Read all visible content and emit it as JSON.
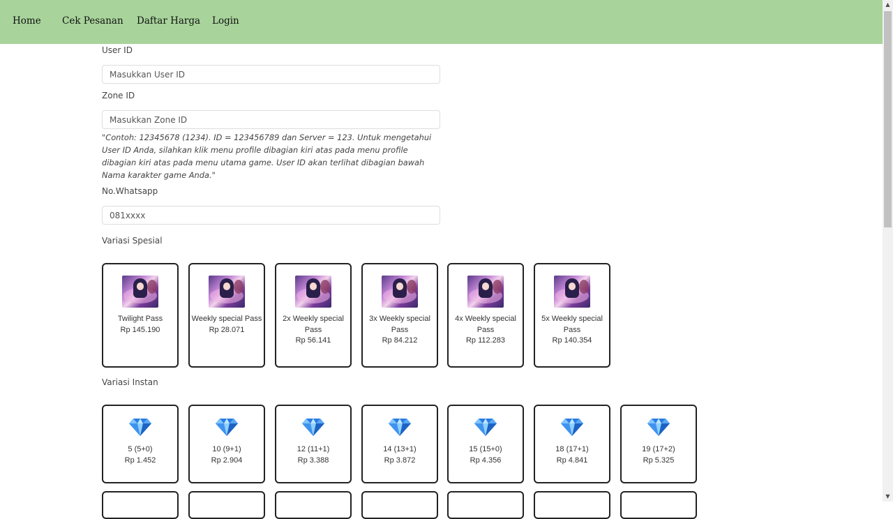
{
  "nav": {
    "items": [
      {
        "label": "Home"
      },
      {
        "label": "Cek Pesanan"
      },
      {
        "label": "Daftar Harga"
      },
      {
        "label": "Login"
      }
    ],
    "bg_color": "#a8d49b"
  },
  "form": {
    "user_id_label": "User ID",
    "user_id_placeholder": "Masukkan User ID",
    "zone_id_label": "Zone ID",
    "zone_id_placeholder": "Masukkan Zone ID",
    "hint": "\"Contoh: 12345678 (1234). ID = 123456789 dan Server = 123. Untuk mengetahui User ID Anda, silahkan klik menu profile dibagian kiri atas pada menu profile dibagian kiri atas pada menu utama game. User ID akan terlihat dibagian bawah Nama karakter game Anda.\"",
    "whatsapp_label": "No.Whatsapp",
    "whatsapp_placeholder": "081xxxx"
  },
  "special": {
    "title": "Variasi Spesial",
    "items": [
      {
        "name": "Twilight Pass",
        "price": "Rp 145.190"
      },
      {
        "name": "Weekly special Pass",
        "price": "Rp 28.071"
      },
      {
        "name": "2x Weekly special Pass",
        "price": "Rp 56.141"
      },
      {
        "name": "3x Weekly special Pass",
        "price": "Rp 84.212"
      },
      {
        "name": "4x Weekly special Pass",
        "price": "Rp 112.283"
      },
      {
        "name": "5x Weekly special Pass",
        "price": "Rp 140.354"
      }
    ]
  },
  "instant": {
    "title": "Variasi Instan",
    "items": [
      {
        "name": "5 (5+0)",
        "price": "Rp 1.452"
      },
      {
        "name": "10 (9+1)",
        "price": "Rp 2.904"
      },
      {
        "name": "12 (11+1)",
        "price": "Rp 3.388"
      },
      {
        "name": "14 (13+1)",
        "price": "Rp 3.872"
      },
      {
        "name": "15 (15+0)",
        "price": "Rp 4.356"
      },
      {
        "name": "18 (17+1)",
        "price": "Rp 4.841"
      },
      {
        "name": "19 (17+2)",
        "price": "Rp 5.325"
      }
    ]
  },
  "icons": {
    "pass_image": "hero-pass-image",
    "diamond": "diamond-icon"
  }
}
